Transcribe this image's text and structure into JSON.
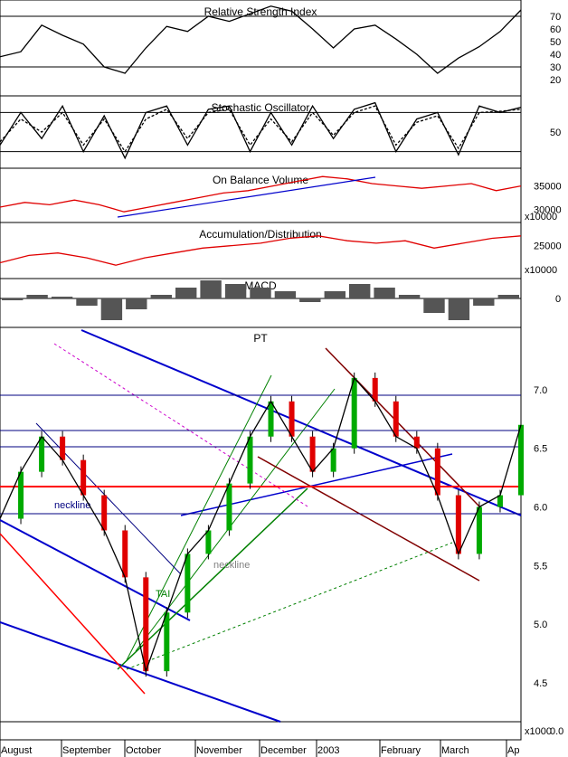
{
  "chart_data": [
    {
      "type": "line",
      "title": "Relative Strength Index",
      "ylim": [
        10,
        80
      ],
      "yticks": [
        "70",
        "60",
        "50",
        "40",
        "30",
        "20"
      ],
      "reference_lines": [
        70,
        30
      ],
      "series": [
        {
          "values": [
            38,
            42,
            63,
            55,
            48,
            30,
            25,
            45,
            62,
            58,
            70,
            66,
            72,
            78,
            74,
            60,
            45,
            60,
            63,
            52,
            40,
            25,
            37,
            46,
            58,
            75
          ]
        }
      ]
    },
    {
      "type": "line",
      "title": "Stochastic Oscillator",
      "ylim": [
        0,
        100
      ],
      "yticks": [
        "50"
      ],
      "reference_lines": [
        80,
        20
      ],
      "series": [
        {
          "values": [
            30,
            80,
            40,
            90,
            20,
            75,
            10,
            80,
            90,
            30,
            85,
            90,
            20,
            80,
            30,
            90,
            40,
            85,
            95,
            20,
            70,
            80,
            15,
            90,
            80,
            88
          ]
        },
        {
          "values": [
            35,
            70,
            50,
            80,
            30,
            70,
            20,
            70,
            85,
            40,
            80,
            85,
            30,
            70,
            35,
            80,
            45,
            80,
            90,
            30,
            65,
            75,
            25,
            80,
            82,
            85
          ]
        }
      ]
    },
    {
      "type": "line",
      "title": "On Balance Volume",
      "yticks": [
        "35000",
        "30000"
      ],
      "ylim": [
        28000,
        38000
      ],
      "unit_label": "x10000",
      "series": [
        {
          "values": [
            30500,
            31500,
            31000,
            32000,
            31000,
            29500,
            30500,
            31500,
            32500,
            33500,
            34000,
            35000,
            36000,
            37000,
            36500,
            35500,
            35000,
            34500,
            35000,
            35500,
            34000,
            35000
          ]
        }
      ]
    },
    {
      "type": "line",
      "title": "Accumulation/Distribution",
      "yticks": [
        "25000"
      ],
      "ylim": [
        19000,
        29000
      ],
      "unit_label": "x10000",
      "series": [
        {
          "values": [
            21500,
            23000,
            23500,
            22500,
            21000,
            22500,
            23500,
            24500,
            25000,
            25500,
            26500,
            27000,
            26000,
            25500,
            26000,
            24500,
            25500,
            26500,
            27000
          ]
        }
      ]
    },
    {
      "type": "bar",
      "title": "MACD",
      "yticks": [
        "0"
      ],
      "values": [
        -0.05,
        0.1,
        0.05,
        -0.2,
        -0.6,
        -0.3,
        0.1,
        0.3,
        0.5,
        0.4,
        0.3,
        0.2,
        -0.1,
        0.2,
        0.4,
        0.3,
        0.1,
        -0.4,
        -0.6,
        -0.2,
        0.1
      ]
    },
    {
      "type": "line",
      "title": "PT",
      "ylim": [
        4.2,
        7.5
      ],
      "yticks": [
        "7.0",
        "6.5",
        "6.0",
        "5.5",
        "5.0",
        "4.5"
      ],
      "xlabels": [
        "August",
        "September",
        "October",
        "November",
        "December",
        "2003",
        "February",
        "March",
        "Ap"
      ],
      "annotations": [
        "neckline",
        "neckline",
        "TAI"
      ],
      "series": [
        {
          "values": [
            5.9,
            6.3,
            6.6,
            6.4,
            6.1,
            5.8,
            5.4,
            4.6,
            5.1,
            5.6,
            5.8,
            6.2,
            6.6,
            6.9,
            6.6,
            6.3,
            6.5,
            7.1,
            6.9,
            6.6,
            6.5,
            6.1,
            5.6,
            6.0,
            6.1,
            6.7
          ]
        }
      ],
      "volume_unit": "x1000",
      "volume_ytick": "0.0"
    }
  ]
}
